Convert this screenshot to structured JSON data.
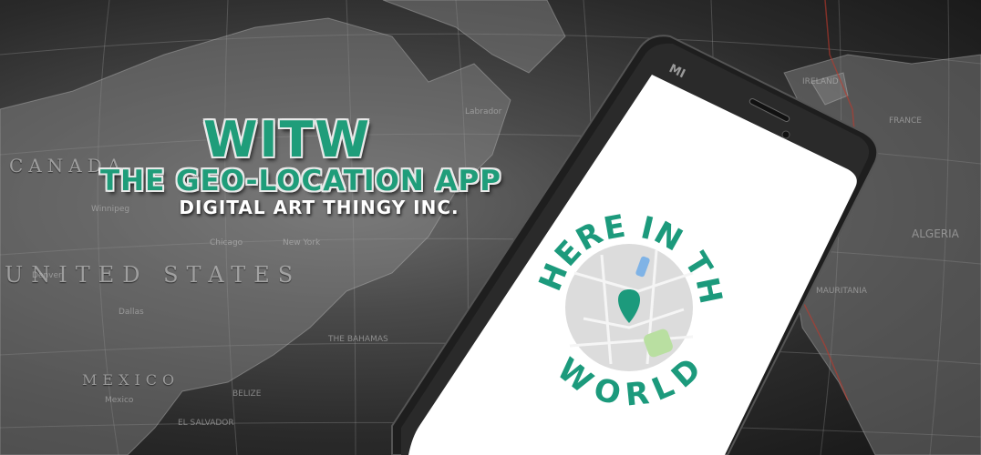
{
  "brand": {
    "title": "WITW",
    "subtitle": "THE GEO-LOCATION APP",
    "company": "DIGITAL ART THINGY INC."
  },
  "map": {
    "regions": [
      "CANADA",
      "UNITED STATES",
      "MEXICO",
      "ALGERIA",
      "MAURITANIA",
      "IRELAND",
      "Labrador",
      "New York",
      "Dallas",
      "Denver",
      "THE BAHAMAS",
      "BELIZE",
      "EL SALVADOR",
      "Mexico",
      "FRANCE",
      "Winnipeg",
      "Chicago"
    ]
  },
  "phone": {
    "brand_mark": "MI",
    "logo": {
      "text_top": "WHERE IN THE",
      "text_bottom": "WORLD",
      "pin_icon": "location-pin-icon"
    }
  },
  "colors": {
    "accent_green": "#1f9d7a",
    "logo_green": "#1c9a7c",
    "phone_body": "#1e1e1e",
    "screen": "#ffffff"
  }
}
